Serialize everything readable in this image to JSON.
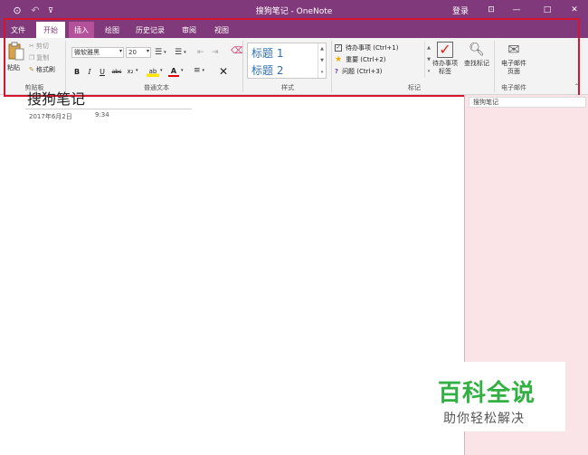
{
  "titlebar": {
    "title": "搜狗笔记 - OneNote",
    "login": "登录",
    "back_icon": "back-circle-icon",
    "undo_icon": "undo-icon",
    "pin_icon": "quick-access-dropdown-icon",
    "share_glyph": "⊡",
    "minimize_glyph": "—",
    "maximize_glyph": "□",
    "close_glyph": "✕",
    "back_glyph": "⊙",
    "undo_glyph": "↶",
    "pin_glyph": "⊽"
  },
  "tabs": [
    {
      "label": "文件"
    },
    {
      "label": "开始"
    },
    {
      "label": "插入"
    },
    {
      "label": "绘图"
    },
    {
      "label": "历史记录"
    },
    {
      "label": "审阅"
    },
    {
      "label": "视图"
    }
  ],
  "ribbon": {
    "clipboard": {
      "paste": "粘贴",
      "cut": "剪切",
      "copy": "复制",
      "format_painter": "格式刷",
      "group": "剪贴板"
    },
    "basic_text": {
      "font": "微软雅黑",
      "size": "20",
      "bold": "B",
      "italic": "I",
      "underline": "U",
      "strike": "abc",
      "subscript": "x₂",
      "highlight": "ab",
      "font_color": "A",
      "clear": "✕",
      "group": "普通文本"
    },
    "styles": {
      "h1": "标题 1",
      "h2": "标题 2",
      "group": "样式"
    },
    "tags": {
      "todo": "待办事项 (Ctrl+1)",
      "important": "重要 (Ctrl+2)",
      "question": "问题 (Ctrl+3)",
      "todo_tag_btn": "待办事项\n标签",
      "find_tags": "查找标记",
      "group": "标记"
    },
    "email": {
      "button": "电子邮件\n页面",
      "group": "电子邮件"
    }
  },
  "note": {
    "title": "搜狗笔记",
    "date": "2017年6月2日",
    "time": "9:34"
  },
  "pages_pane": {
    "item": "搜狗笔记"
  },
  "watermark": {
    "line1": "百科全说",
    "line2": "助你轻松解决"
  },
  "colors": {
    "accent": "#80397b",
    "highlight_tab": "#b3519b",
    "annotation_red": "#d7152f",
    "pane_bg": "#fbe4e8",
    "watermark_green": "#33b043"
  }
}
